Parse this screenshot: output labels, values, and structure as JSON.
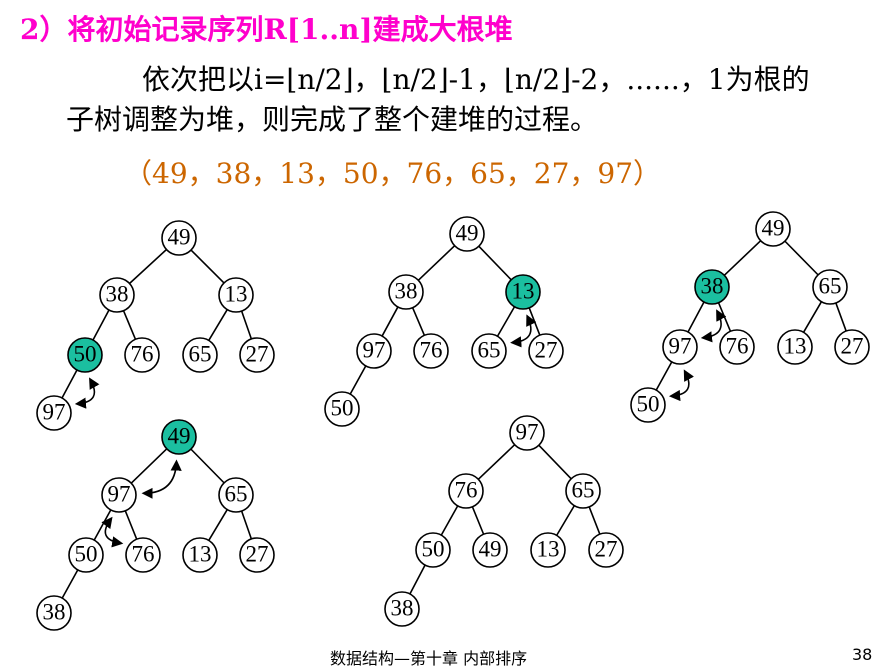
{
  "title": "2）将初始记录序列R[1..n]建成大根堆",
  "paragraph": {
    "line1": "依次把以i=⌊n/2⌋，⌊n/2⌋-1，⌊n/2⌋-2，......，1为根的",
    "line2": "子树调整为堆，则完成了整个建堆的过程。"
  },
  "sequence": "（49，38，13，50，76，65，27，97）",
  "colors": {
    "title": "#ff00cc",
    "sequence": "#cc6600",
    "highlight": "#1bbfa0",
    "node_fill": "#ffffff",
    "stroke": "#000000"
  },
  "trees": [
    {
      "nodes": [
        {
          "id": "a1",
          "label": "49"
        },
        {
          "id": "a2",
          "label": "38"
        },
        {
          "id": "a3",
          "label": "13"
        },
        {
          "id": "a4",
          "label": "50",
          "highlight": true
        },
        {
          "id": "a5",
          "label": "76"
        },
        {
          "id": "a6",
          "label": "65"
        },
        {
          "id": "a7",
          "label": "27"
        },
        {
          "id": "a8",
          "label": "97"
        }
      ],
      "edges": [
        [
          "a1",
          "a2"
        ],
        [
          "a1",
          "a3"
        ],
        [
          "a2",
          "a4"
        ],
        [
          "a2",
          "a5"
        ],
        [
          "a3",
          "a6"
        ],
        [
          "a3",
          "a7"
        ],
        [
          "a4",
          "a8"
        ]
      ],
      "swaps": [
        [
          "a4",
          "a8"
        ]
      ]
    },
    {
      "nodes": [
        {
          "id": "b1",
          "label": "49"
        },
        {
          "id": "b2",
          "label": "38"
        },
        {
          "id": "b3",
          "label": "13",
          "highlight": true
        },
        {
          "id": "b4",
          "label": "97"
        },
        {
          "id": "b5",
          "label": "76"
        },
        {
          "id": "b6",
          "label": "65"
        },
        {
          "id": "b7",
          "label": "27"
        },
        {
          "id": "b8",
          "label": "50"
        }
      ],
      "edges": [
        [
          "b1",
          "b2"
        ],
        [
          "b1",
          "b3"
        ],
        [
          "b2",
          "b4"
        ],
        [
          "b2",
          "b5"
        ],
        [
          "b3",
          "b6"
        ],
        [
          "b3",
          "b7"
        ],
        [
          "b4",
          "b8"
        ]
      ],
      "swaps": [
        [
          "b3",
          "b6"
        ]
      ]
    },
    {
      "nodes": [
        {
          "id": "c1",
          "label": "49"
        },
        {
          "id": "c2",
          "label": "38",
          "highlight": true
        },
        {
          "id": "c3",
          "label": "65"
        },
        {
          "id": "c4",
          "label": "97"
        },
        {
          "id": "c5",
          "label": "76"
        },
        {
          "id": "c6",
          "label": "13"
        },
        {
          "id": "c7",
          "label": "27"
        },
        {
          "id": "c8",
          "label": "50"
        }
      ],
      "edges": [
        [
          "c1",
          "c2"
        ],
        [
          "c1",
          "c3"
        ],
        [
          "c2",
          "c4"
        ],
        [
          "c2",
          "c5"
        ],
        [
          "c3",
          "c6"
        ],
        [
          "c3",
          "c7"
        ],
        [
          "c4",
          "c8"
        ]
      ],
      "swaps": [
        [
          "c2",
          "c4"
        ],
        [
          "c4",
          "c8"
        ]
      ]
    },
    {
      "nodes": [
        {
          "id": "d1",
          "label": "49",
          "highlight": true
        },
        {
          "id": "d2",
          "label": "97"
        },
        {
          "id": "d3",
          "label": "65"
        },
        {
          "id": "d4",
          "label": "50"
        },
        {
          "id": "d5",
          "label": "76"
        },
        {
          "id": "d6",
          "label": "13"
        },
        {
          "id": "d7",
          "label": "27"
        },
        {
          "id": "d8",
          "label": "38"
        }
      ],
      "edges": [
        [
          "d1",
          "d2"
        ],
        [
          "d1",
          "d3"
        ],
        [
          "d2",
          "d4"
        ],
        [
          "d2",
          "d5"
        ],
        [
          "d3",
          "d6"
        ],
        [
          "d3",
          "d7"
        ],
        [
          "d4",
          "d8"
        ]
      ],
      "swaps": [
        [
          "d1",
          "d2"
        ],
        [
          "d2",
          "d5"
        ]
      ]
    },
    {
      "nodes": [
        {
          "id": "e1",
          "label": "97"
        },
        {
          "id": "e2",
          "label": "76"
        },
        {
          "id": "e3",
          "label": "65"
        },
        {
          "id": "e4",
          "label": "50"
        },
        {
          "id": "e5",
          "label": "49"
        },
        {
          "id": "e6",
          "label": "13"
        },
        {
          "id": "e7",
          "label": "27"
        },
        {
          "id": "e8",
          "label": "38"
        }
      ],
      "edges": [
        [
          "e1",
          "e2"
        ],
        [
          "e1",
          "e3"
        ],
        [
          "e2",
          "e4"
        ],
        [
          "e2",
          "e5"
        ],
        [
          "e3",
          "e6"
        ],
        [
          "e3",
          "e7"
        ],
        [
          "e4",
          "e8"
        ]
      ],
      "swaps": []
    }
  ],
  "footer": "数据结构—第十章 内部排序",
  "page_number": "38"
}
